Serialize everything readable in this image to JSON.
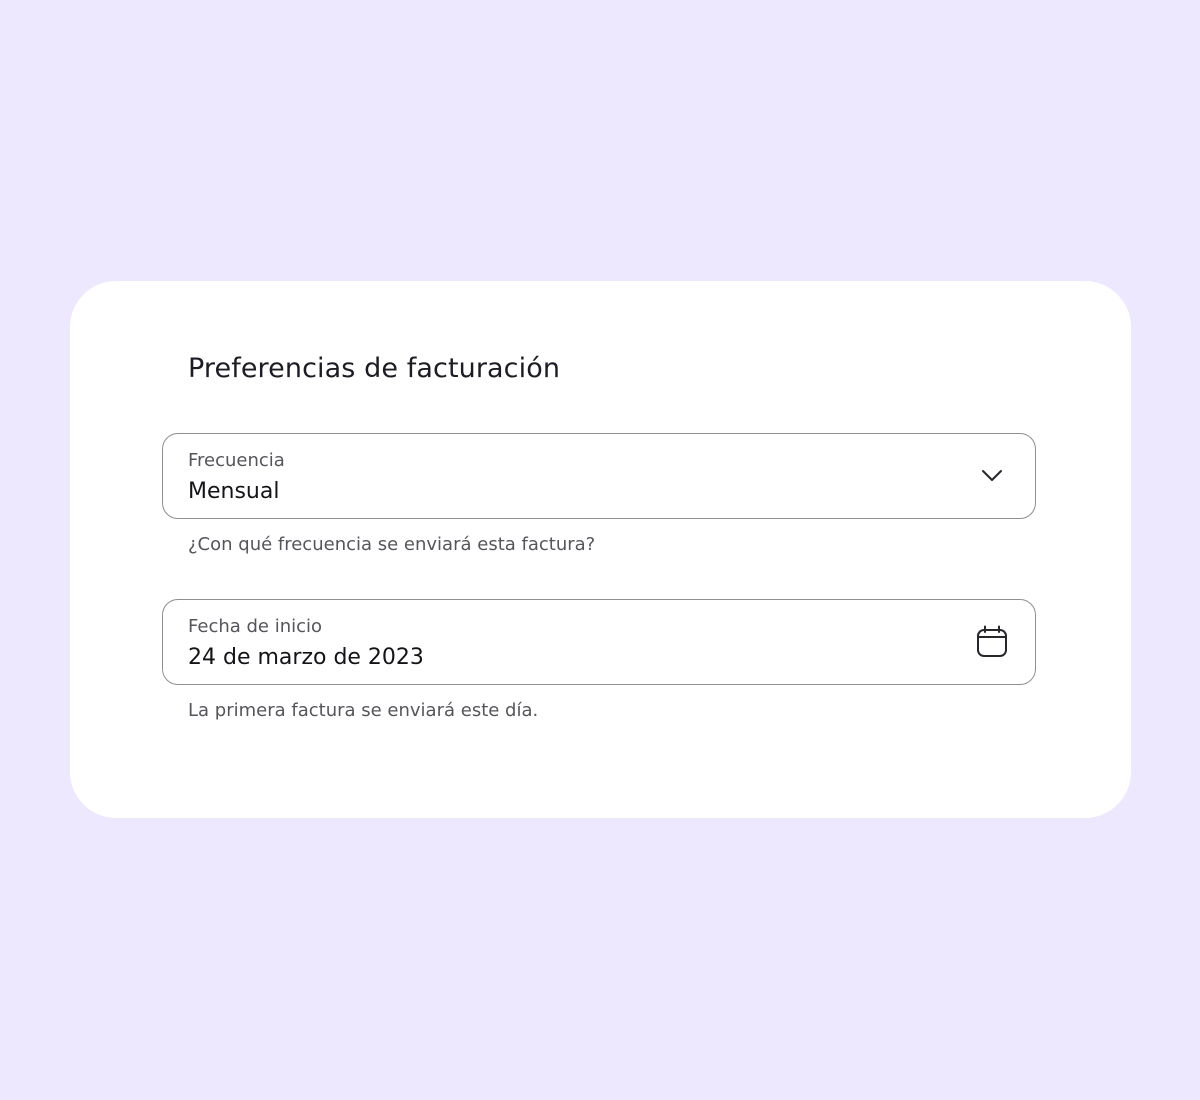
{
  "card": {
    "title": "Preferencias de facturación"
  },
  "frequency_field": {
    "label": "Frecuencia",
    "value": "Mensual",
    "icon": "chevron-down-icon",
    "helper": "¿Con qué frecuencia se enviará esta factura?"
  },
  "start_date_field": {
    "label": "Fecha de inicio",
    "value": "24 de marzo de 2023",
    "icon": "calendar-icon",
    "helper": "La primera factura se enviará este día."
  },
  "colors": {
    "page_background": "#ede8fd",
    "card_background": "#ffffff",
    "field_border": "#8f8f93",
    "primary_text": "#141418",
    "secondary_text": "#55555b"
  }
}
